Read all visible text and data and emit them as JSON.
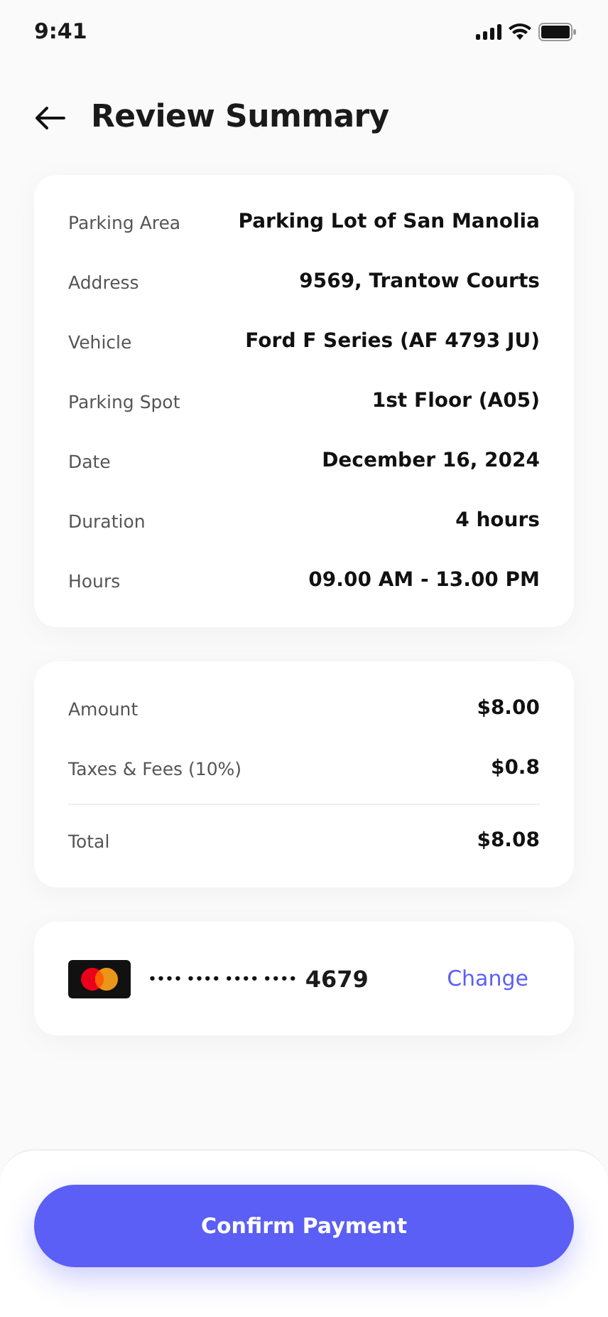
{
  "status_bar": {
    "time": "9:41"
  },
  "header": {
    "title": "Review Summary"
  },
  "details": [
    {
      "label": "Parking Area",
      "value": "Parking Lot of San Manolia"
    },
    {
      "label": "Address",
      "value": "9569, Trantow Courts"
    },
    {
      "label": "Vehicle",
      "value": "Ford F Series (AF 4793 JU)"
    },
    {
      "label": "Parking Spot",
      "value": "1st Floor (A05)"
    },
    {
      "label": "Date",
      "value": "December 16, 2024"
    },
    {
      "label": "Duration",
      "value": "4 hours"
    },
    {
      "label": "Hours",
      "value": "09.00 AM - 13.00 PM"
    }
  ],
  "pricing": [
    {
      "kind": "line",
      "label": "Amount",
      "value": "$8.00"
    },
    {
      "kind": "line",
      "label": "Taxes & Fees (10%)",
      "value": "$0.8"
    },
    {
      "kind": "total",
      "label": "Total",
      "value": "$8.08"
    }
  ],
  "payment": {
    "masked": "•••• •••• •••• ••••",
    "last4": "4679",
    "action": "Change"
  },
  "primary_button": "Confirm Payment"
}
